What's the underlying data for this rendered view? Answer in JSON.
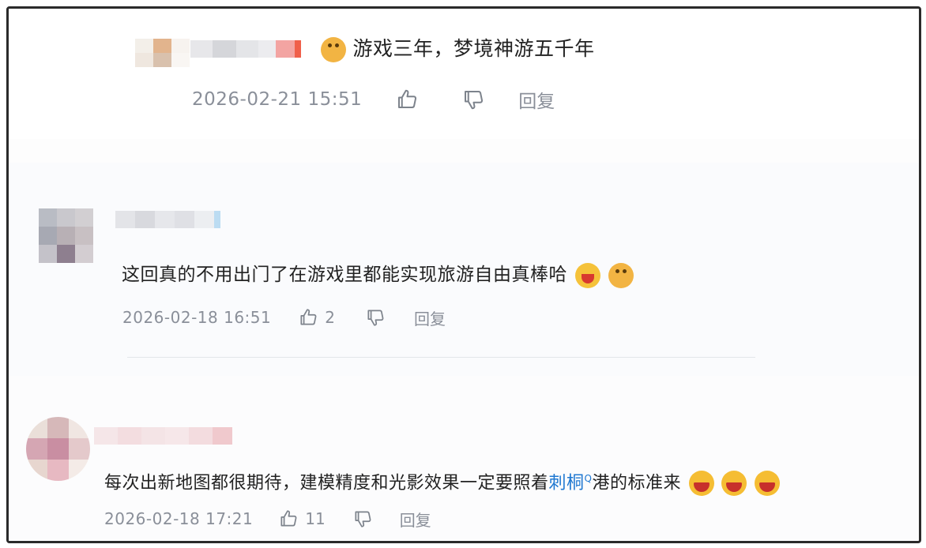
{
  "comments": [
    {
      "text": "游戏三年，梦境神游五千年",
      "emojis_before": [
        "cat-emoji"
      ],
      "date": "2026-02-21 15:51",
      "likes": "",
      "reply_label": "回复"
    },
    {
      "text": "这回真的不用出门了在游戏里都能实现旅游自由真棒哈",
      "emojis_after": [
        "yell-emoji",
        "cat-emoji"
      ],
      "date": "2026-02-18 16:51",
      "likes": "2",
      "reply_label": "回复"
    },
    {
      "text_before_link": "每次出新地图都很期待，建模精度和光影效果一定要照着",
      "link": "刺桐",
      "link_sup": "Q",
      "text_after_link": "港的标准来",
      "emojis_after": [
        "laugh-emoji",
        "laugh-emoji",
        "laugh-emoji"
      ],
      "date": "2026-02-18 17:21",
      "likes": "11",
      "reply_label": "回复"
    }
  ],
  "colors": {
    "text": "#222222",
    "meta": "#8a8f99",
    "link": "#1f78d1",
    "frame": "#2a2a2a"
  }
}
